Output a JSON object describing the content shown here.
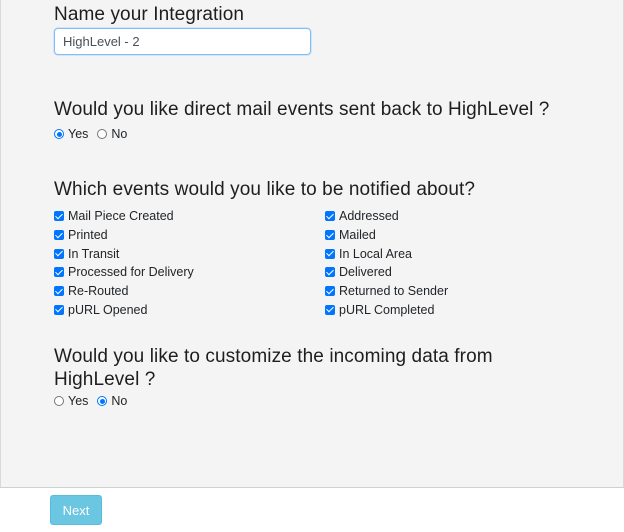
{
  "integration_name": {
    "heading": "Name your Integration",
    "value": "HighLevel - 2"
  },
  "mail_events": {
    "question": "Would you like direct mail events sent back to HighLevel ?",
    "options": [
      {
        "label": "Yes",
        "checked": true
      },
      {
        "label": "No",
        "checked": false
      }
    ]
  },
  "notify_events": {
    "question": "Which events would you like to be notified about?",
    "left": [
      {
        "label": "Mail Piece Created",
        "checked": true
      },
      {
        "label": "Printed",
        "checked": true
      },
      {
        "label": "In Transit",
        "checked": true
      },
      {
        "label": "Processed for Delivery",
        "checked": true
      },
      {
        "label": "Re-Routed",
        "checked": true
      },
      {
        "label": "pURL Opened",
        "checked": true
      }
    ],
    "right": [
      {
        "label": "Addressed",
        "checked": true
      },
      {
        "label": "Mailed",
        "checked": true
      },
      {
        "label": "In Local Area",
        "checked": true
      },
      {
        "label": "Delivered",
        "checked": true
      },
      {
        "label": "Returned to Sender",
        "checked": true
      },
      {
        "label": "pURL Completed",
        "checked": true
      }
    ]
  },
  "customize_data": {
    "question": "Would you like to customize the incoming data from HighLevel ?",
    "options": [
      {
        "label": "Yes",
        "checked": false
      },
      {
        "label": "No",
        "checked": true
      }
    ]
  },
  "footer": {
    "next_label": "Next"
  }
}
